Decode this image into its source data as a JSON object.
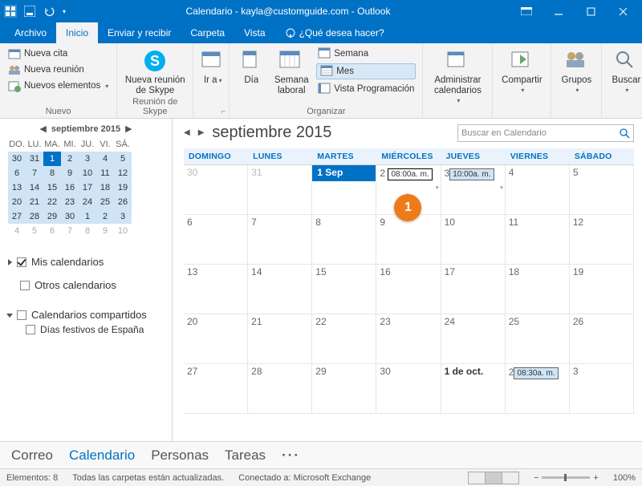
{
  "titlebar": {
    "title": "Calendario - kayla@customguide.com - Outlook"
  },
  "menu": {
    "archivo": "Archivo",
    "inicio": "Inicio",
    "enviar": "Enviar y recibir",
    "carpeta": "Carpeta",
    "vista": "Vista",
    "tellme": "¿Qué desea hacer?"
  },
  "ribbon": {
    "nueva_cita": "Nueva cita",
    "nueva_reunion": "Nueva reunión",
    "nuevos_elementos": "Nuevos elementos",
    "grupo_nuevo": "Nuevo",
    "skype": "Nueva reunión de Skype",
    "grupo_skype": "Reunión de Skype",
    "ir_a": "Ir a",
    "dia": "Día",
    "semana_laboral": "Semana laboral",
    "semana": "Semana",
    "mes": "Mes",
    "vista_prog": "Vista Programación",
    "grupo_organizar": "Organizar",
    "administrar": "Administrar calendarios",
    "compartir": "Compartir",
    "grupos": "Grupos",
    "buscar": "Buscar"
  },
  "mini_cal": {
    "title": "septiembre 2015",
    "days": [
      "DO.",
      "LU.",
      "MA.",
      "MI.",
      "JU.",
      "VI.",
      "SÁ."
    ]
  },
  "cal_tree": {
    "mis": "Mis calendarios",
    "otros": "Otros calendarios",
    "compartidos": "Calendarios compartidos",
    "festivos": "Días festivos de España"
  },
  "main": {
    "title": "septiembre 2015",
    "search_placeholder": "Buscar en Calendario",
    "headers": [
      "DOMINGO",
      "LUNES",
      "MARTES",
      "MIÉRCOLES",
      "JUEVES",
      "VIERNES",
      "SÁBADO"
    ],
    "today_label": "1 Sep",
    "oct1_label": "1 de oct.",
    "evt_sep2": "08:00a. m.",
    "evt_sep3": "10:00a. m.",
    "evt_oct2": "08:30a. m.",
    "callout": "1"
  },
  "nav": {
    "correo": "Correo",
    "calendario": "Calendario",
    "personas": "Personas",
    "tareas": "Tareas"
  },
  "status": {
    "elementos": "Elementos: 8",
    "carpetas": "Todas las carpetas están actualizadas.",
    "conectado": "Conectado a: Microsoft Exchange",
    "zoom": "100%"
  }
}
